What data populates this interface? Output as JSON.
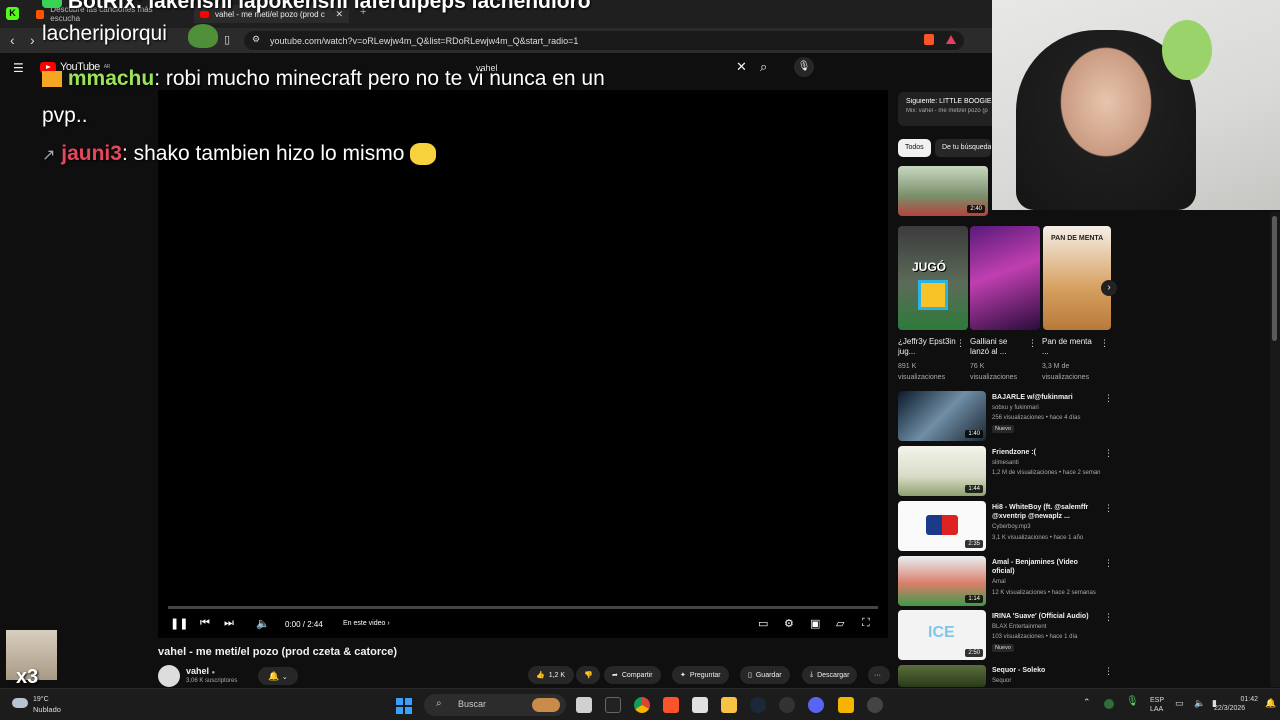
{
  "browser": {
    "overlay_top_text": "BotRix: lakenshi lapokenshi laferdipeps lachendioro",
    "overlay_left_text": "lacheripiorqui",
    "tabs": [
      {
        "label": "Descubre las canciones más escucha"
      },
      {
        "label": "vahel - me meti/el pozo (prod c"
      }
    ],
    "url": "youtube.com/watch?v=oRLewjw4m_Q&list=RDoRLewjw4m_Q&start_radio=1"
  },
  "youtube": {
    "logo": "YouTube",
    "logo_sup": "AR",
    "search_value": "vahel"
  },
  "chat": [
    {
      "user": "mmachu",
      "message": ": robi mucho minecraft pero no te vi nunca en un",
      "cont": "pvp.."
    },
    {
      "user": "jauni3",
      "message": ": shako tambien hizo lo mismo"
    }
  ],
  "player": {
    "time": "0:00 / 2:44",
    "chapter": "En este video",
    "progress": 0.0
  },
  "video": {
    "title": "vahel - me meti/el pozo (prod czeta & catorce)",
    "channel": "vahel",
    "subscribers": "3,06 K suscriptores",
    "likes": "1,2 K",
    "share": "Compartir",
    "ask": "Preguntar",
    "save": "Guardar",
    "download": "Descargar"
  },
  "sidebar": {
    "next_title": "Siguiente: LITTLE BOOGIE",
    "next_sub": "Mix: vahel - me meti/el pozo (p",
    "chips": [
      "Todos",
      "De tu búsqueda"
    ],
    "first_duration": "2:40",
    "shorts": [
      {
        "title": "¿Jeffr3y Epst3in jug...",
        "views": "891 K visualizaciones",
        "thumb_text": "JUGÓ"
      },
      {
        "title": "Galliani se lanzó al ...",
        "views": "76 K visualizaciones"
      },
      {
        "title": "Pan de menta ...",
        "views": "3,3 M de visualizaciones",
        "thumb_text": "PAN DE MENTA"
      }
    ],
    "videos": [
      {
        "title": "BAJARLE w/@fukinmari",
        "channel": "sobxu y fukinmari",
        "meta": "256 visualizaciones • hace 4 días",
        "badge": "Nuevo",
        "duration": "1:40"
      },
      {
        "title": "Friendzone :(",
        "channel": "slimesanti",
        "meta": "1,2 M de visualizaciones • hace 2 seman",
        "duration": "1:44"
      },
      {
        "title": "Hi8 - WhiteBoy (ft. @salemffr @xventrip @newaplz ...",
        "channel": "Cyberboy.mp3",
        "meta": "3,1 K visualizaciones • hace 1 año",
        "duration": "2:35"
      },
      {
        "title": "Amal - Benjamines (Video oficial)",
        "channel": "Amal",
        "meta": "12 K visualizaciones • hace 2 semanas",
        "duration": "1:14"
      },
      {
        "title": "IRINA 'Suave' (Official Audio)",
        "channel": "BLAX Entertainment",
        "meta": "103 visualizaciones • hace 1 día",
        "badge": "Nuevo",
        "duration": "2:50",
        "thumb_text": "ICE"
      },
      {
        "title": "Sequor - Soleko",
        "channel": "Sequor"
      }
    ]
  },
  "taskbar": {
    "temp": "19°C",
    "weather": "Nublado",
    "search": "Buscar",
    "lang1": "ESP",
    "lang2": "LAA",
    "clock": "01:42",
    "date": "22/3/2026"
  },
  "overlay_badge": "x3",
  "colors": {
    "bg": "#0f0f0f",
    "yt_red": "#ff0000",
    "chat_user1": "#9be45a",
    "chat_user2": "#e8475b",
    "botrix_green": "#39d353"
  }
}
